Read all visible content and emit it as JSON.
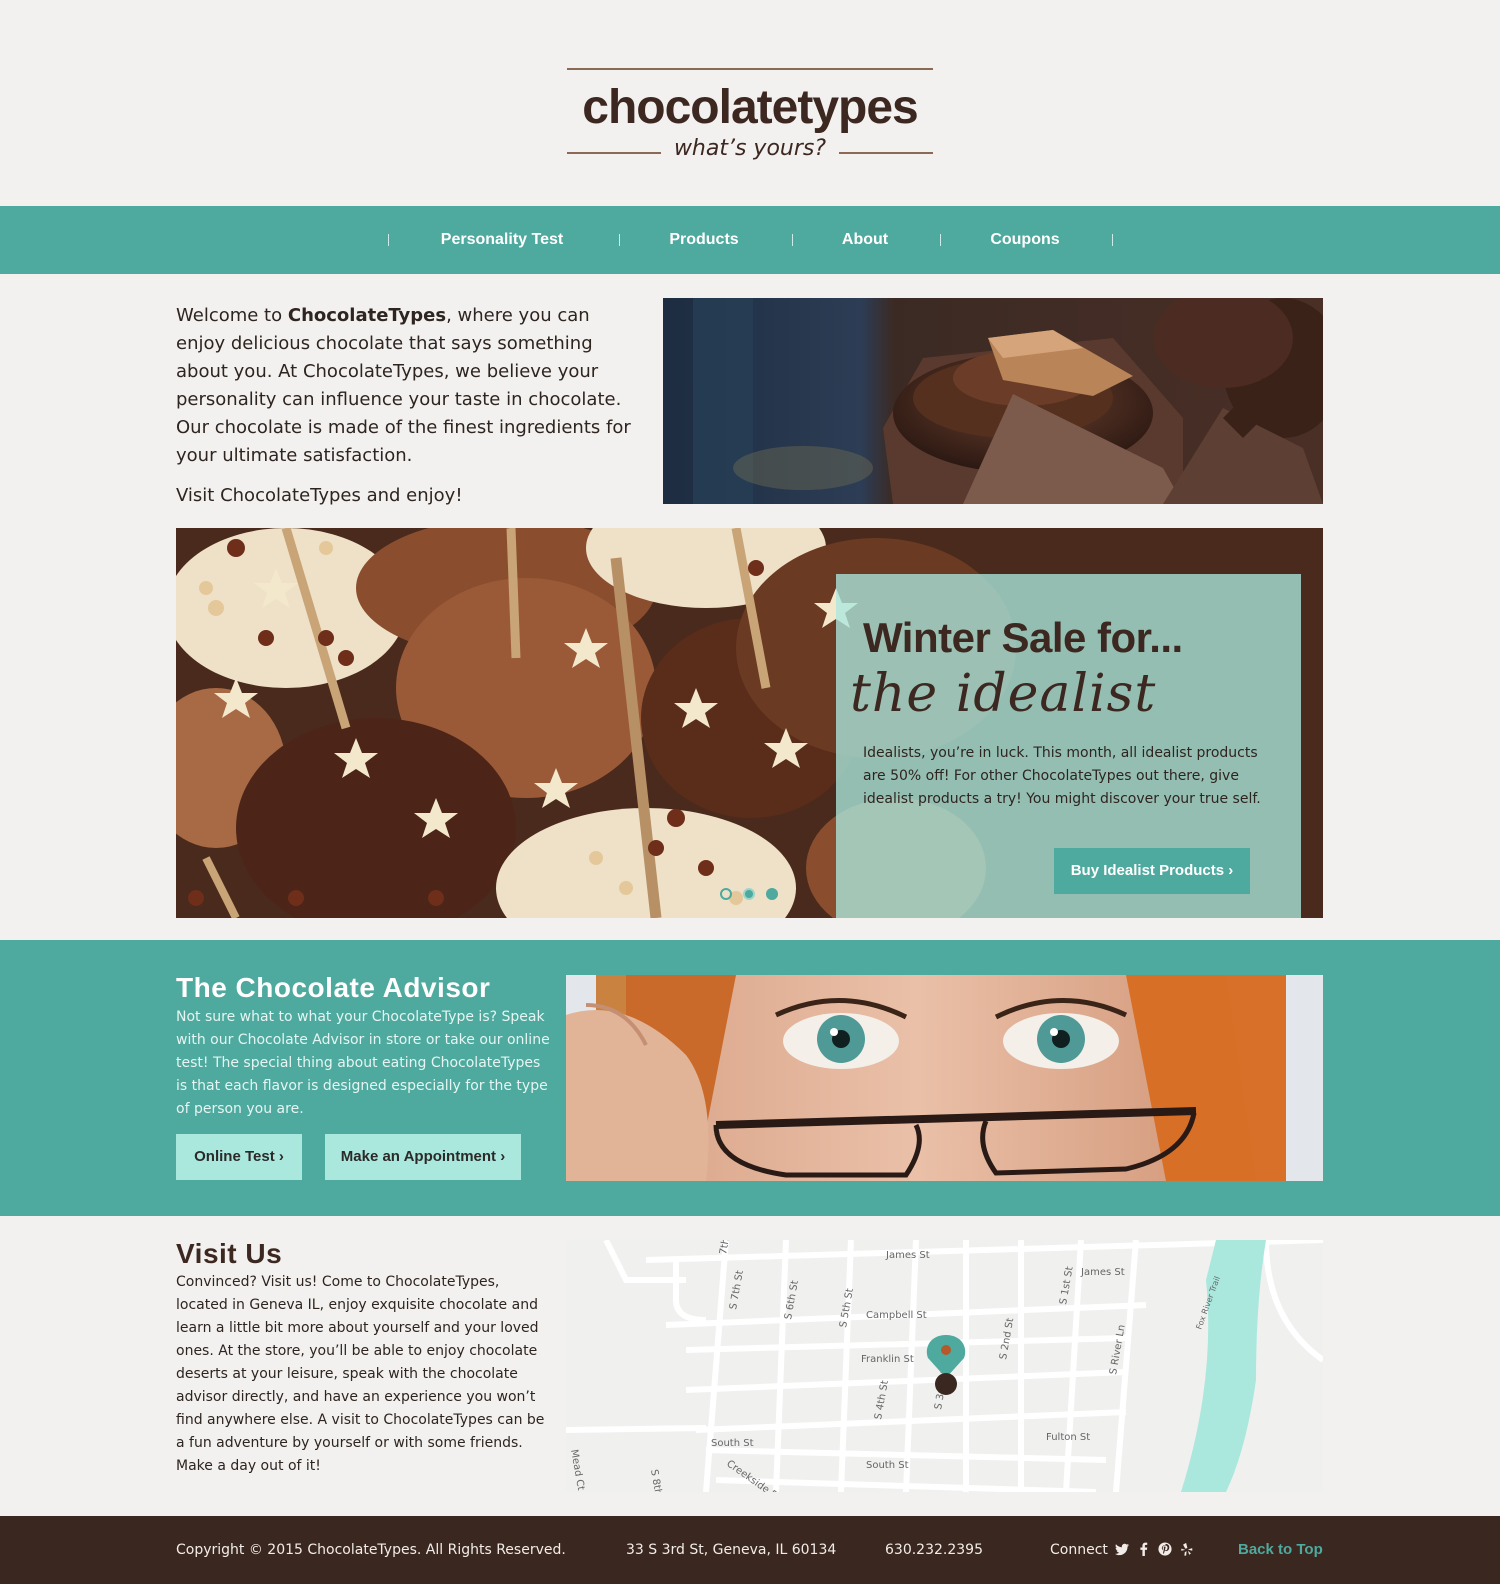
{
  "brand": {
    "name": "chocolatetypes",
    "tagline": "what’s yours?"
  },
  "nav": {
    "items": [
      "Personality Test",
      "Products",
      "About",
      "Coupons"
    ]
  },
  "intro": {
    "welcome_prefix": "Welcome to ",
    "brand_bold": "ChocolateTypes",
    "welcome_suffix": ", where you can enjoy delicious chocolate that says something about you. At ChocolateTypes, we believe your personality can influence your taste in chocolate. Our chocolate is made of the finest ingredients for your ultimate satisfaction.",
    "visit": "Visit ChocolateTypes and enjoy!"
  },
  "slider": {
    "title": "Winter Sale for...",
    "script": "the idealist",
    "body": "Idealists, you’re in luck.  This month, all idealist products are 50% off! For other ChocolateTypes out there, give idealist products a try! You might discover your true self.",
    "button": "Buy Idealist Products ›",
    "dots_count": 3,
    "active_dot": 1
  },
  "advisor": {
    "title": "The Chocolate Advisor",
    "body": "Not sure what to what your ChocolateType is? Speak with our Chocolate Advisor in store or take our online test! The special thing about eating ChocolateTypes is that each flavor is designed especially for the type of person you are.",
    "btn_test": "Online Test ›",
    "btn_appt": "Make an Appointment ›"
  },
  "visit": {
    "title": "Visit Us",
    "body": "Convinced? Visit us! Come to ChocolateTypes, located in Geneva IL, enjoy exquisite chocolate and learn a little bit more about yourself and your loved ones. At the store, you’ll be able to enjoy chocolate deserts at your leisure, speak with the chocolate advisor directly, and have an experience you won’t find anywhere else. A visit to ChocolateTypes can be a fun adventure by yourself or with some friends. Make a day out of it!"
  },
  "map": {
    "streets": [
      "James St",
      "Campbell St",
      "Franklin St",
      "South St",
      "Fulton St",
      "S 7th St",
      "S 6th St",
      "S 5th St",
      "S 4th St",
      "S 3rd St",
      "S 2nd St",
      "S 1st St",
      "S River Ln",
      "S 8th St",
      "Fox River Trail",
      "Mead Ct",
      "Creekside Dr",
      "James St",
      "7th"
    ]
  },
  "footer": {
    "copyright": "Copyright © 2015 ChocolateTypes. All Rights Reserved.",
    "address": "33 S 3rd St, Geneva, IL 60134",
    "phone": "630.232.2395",
    "connect": "Connect",
    "back_to_top": "Back to Top"
  },
  "colors": {
    "teal": "#4ea99e",
    "mint": "#aae8de",
    "brown": "#3a2820",
    "bg": "#f2f1ef"
  },
  "icons": [
    "twitter-icon",
    "facebook-icon",
    "pinterest-icon",
    "yelp-icon",
    "map-pin-icon",
    "chevron-right-icon"
  ]
}
